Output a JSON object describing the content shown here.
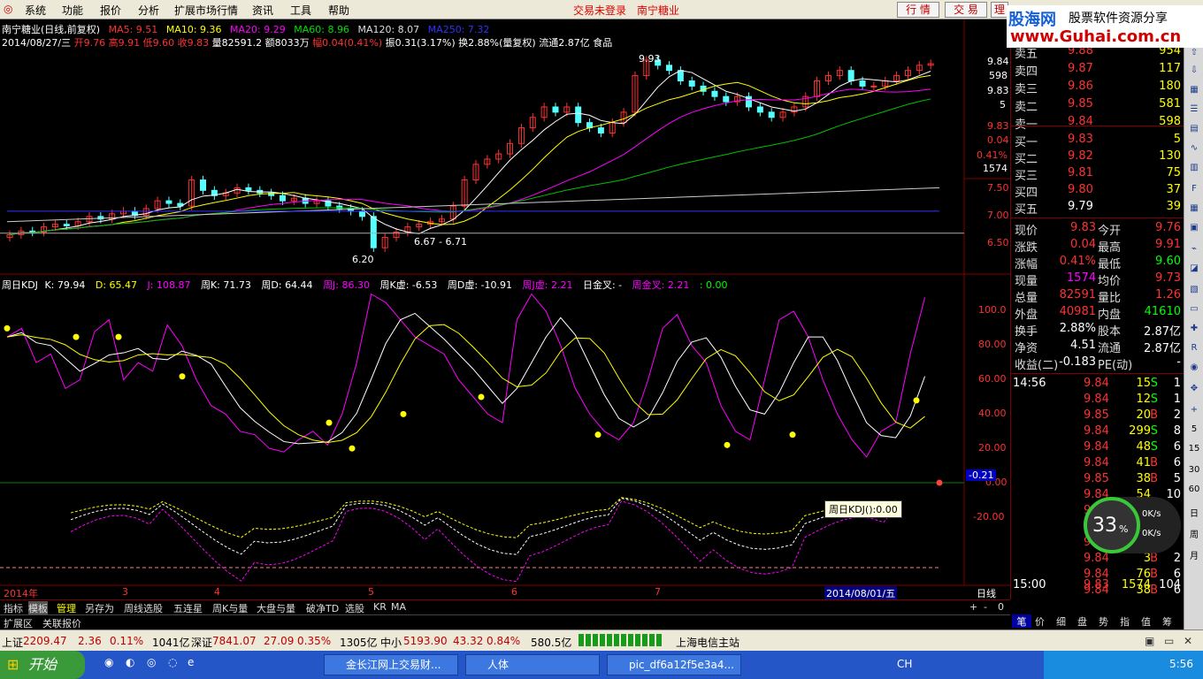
{
  "menu": {
    "items": [
      "系统",
      "功能",
      "报价",
      "分析",
      "扩展市场行情",
      "资讯",
      "工具",
      "帮助"
    ],
    "login_status": "交易未登录",
    "stock_name": "南宁糖业",
    "btn_quote": "行 情",
    "btn_trade": "交 易",
    "btn_more": "理"
  },
  "logo": {
    "brand": "股海网",
    "tagline": "股票软件资源分享",
    "url": "www.Guhai.com.cn"
  },
  "chart_header": {
    "line1": "南宁糖业(日线,前复权)",
    "ma5": "MA5: 9.51",
    "ma10": "MA10: 9.36",
    "ma20": "MA20: 9.29",
    "ma60": "MA60: 8.96",
    "ma120": "MA120: 8.07",
    "ma250": "MA250: 7.32",
    "line2": "2014/08/27/三",
    "open": "开9.76",
    "high": "高9.91",
    "low": "低9.60",
    "close": "收9.83",
    "vol": "量82591.2",
    "amt": "额8033万",
    "chg": "幅0.04(0.41%)",
    "amp": "振0.31(3.17%)",
    "turn": "换2.88%(量复权)",
    "float": "流通2.87亿",
    "sector": "食品"
  },
  "price_labels": {
    "high_mark": "9.93",
    "low_mark": "6.20",
    "range_mark": "6.67 - 6.71"
  },
  "price_axis": [
    "9.84",
    "598",
    "9.83",
    "5",
    "9.83",
    "0.04",
    "0.41%",
    "1574",
    "7.50",
    "7.00",
    "6.50"
  ],
  "kdj_header": {
    "title": "周日KDJ",
    "k": "K: 79.94",
    "d": "D: 65.47",
    "j": "J: 108.87",
    "wk": "周K: 71.73",
    "wd": "周D: 64.44",
    "wj": "周J: 86.30",
    "wkx": "周K虚: -6.53",
    "wdx": "周D虚: -10.91",
    "wjx": "周J虚: 2.21",
    "gold": "日金叉: -",
    "wgold": "周金叉: 2.21",
    "zero": ": 0.00"
  },
  "kdj_axis": [
    "100.0",
    "80.00",
    "60.00",
    "40.00",
    "20.00",
    "0.00",
    "-20.00"
  ],
  "kdj_current": "-0.21",
  "kdj_tooltip": "周日KDJ():0.00",
  "time_axis": {
    "year": "2014年",
    "m3": "3",
    "m4": "4",
    "m5": "5",
    "m6": "6",
    "m7": "7",
    "date": "2014/08/01/五",
    "period": "日线"
  },
  "order_book": {
    "sell": [
      [
        "卖五",
        "9.88",
        "954"
      ],
      [
        "卖四",
        "9.87",
        "117"
      ],
      [
        "卖三",
        "9.86",
        "180"
      ],
      [
        "卖二",
        "9.85",
        "581"
      ],
      [
        "卖一",
        "9.84",
        "598"
      ]
    ],
    "buy": [
      [
        "买一",
        "9.83",
        "5"
      ],
      [
        "买二",
        "9.82",
        "130"
      ],
      [
        "买三",
        "9.81",
        "75"
      ],
      [
        "买四",
        "9.80",
        "37"
      ],
      [
        "买五",
        "9.79",
        "39"
      ]
    ]
  },
  "quote": [
    [
      "现价",
      "9.83",
      "今开",
      "9.76"
    ],
    [
      "涨跌",
      "0.04",
      "最高",
      "9.91"
    ],
    [
      "涨幅",
      "0.41%",
      "最低",
      "9.60"
    ],
    [
      "现量",
      "1574",
      "均价",
      "9.73"
    ],
    [
      "总量",
      "82591",
      "量比",
      "1.26"
    ],
    [
      "外盘",
      "40981",
      "内盘",
      "41610"
    ],
    [
      "换手",
      "2.88%",
      "股本",
      "2.87亿"
    ],
    [
      "净资",
      "4.51",
      "流通",
      "2.87亿"
    ],
    [
      "收益(二)",
      "-0.183",
      "PE(动)",
      "-"
    ]
  ],
  "ticks": [
    [
      "14:56",
      "9.84",
      "15",
      "S",
      "1"
    ],
    [
      "",
      "9.84",
      "12",
      "S",
      "1"
    ],
    [
      "",
      "9.85",
      "20",
      "B",
      "2"
    ],
    [
      "",
      "9.84",
      "299",
      "S",
      "8"
    ],
    [
      "",
      "9.84",
      "48",
      "S",
      "6"
    ],
    [
      "",
      "9.84",
      "41",
      "B",
      "6"
    ],
    [
      "",
      "9.85",
      "38",
      "B",
      "5"
    ],
    [
      "",
      "9.84",
      "54",
      "",
      "10"
    ],
    [
      "",
      "9.8",
      "",
      "",
      ""
    ],
    [
      "",
      "9.8",
      "",
      "",
      ""
    ],
    [
      "",
      "9.8",
      "",
      "",
      ""
    ],
    [
      "",
      "9.84",
      "3",
      "B",
      "2"
    ],
    [
      "",
      "9.84",
      "76",
      "B",
      "6"
    ],
    [
      "",
      "9.84",
      "38",
      "B",
      "6"
    ],
    [
      "15:00",
      "9.83",
      "1574",
      "",
      "104"
    ]
  ],
  "speed": {
    "pct": "33",
    "unit": "%",
    "up": "0K/s",
    "down": "0K/s"
  },
  "bottom_tabs": [
    "指标",
    "模板",
    "管理",
    "另存为",
    "周线选股",
    "五连星",
    "周K与量",
    "大盘与量",
    "破净TD",
    "选股",
    "KR",
    "MA"
  ],
  "bottom_tabs2": [
    "扩展区",
    "关联报价"
  ],
  "right_tabs": [
    "笔",
    "价",
    "细",
    "盘",
    "势",
    "指",
    "值",
    "筹"
  ],
  "status": {
    "sh_label": "上证",
    "sh_val": "2209.47",
    "sh_chg": "2.36",
    "sh_pct": "0.11%",
    "sh_amt": "1041亿",
    "sz_label": "深证",
    "sz_val": "7841.07",
    "sz_chg": "27.09",
    "sz_pct": "0.35%",
    "sz_amt": "1305亿",
    "zx_label": "中小",
    "zx_val": "5193.90",
    "zx_chg": "43.32",
    "zx_pct": "0.84%",
    "zx_amt": "580.5亿",
    "server": "上海电信主站"
  },
  "taskbar": {
    "start": "开始",
    "tasks": [
      "金长江网上交易财...",
      "人体",
      "pic_df6a12f5e3a4..."
    ],
    "lang": "CH",
    "clock": "5:56"
  },
  "colors": {
    "up": "#ff3232",
    "down": "#54ffff",
    "ma5": "#ffffff",
    "ma10": "#ffff00",
    "ma20": "#ff00ff",
    "ma60": "#00c000",
    "ma120": "#cccccc",
    "ma250": "#3030ff",
    "border": "#800000"
  }
}
